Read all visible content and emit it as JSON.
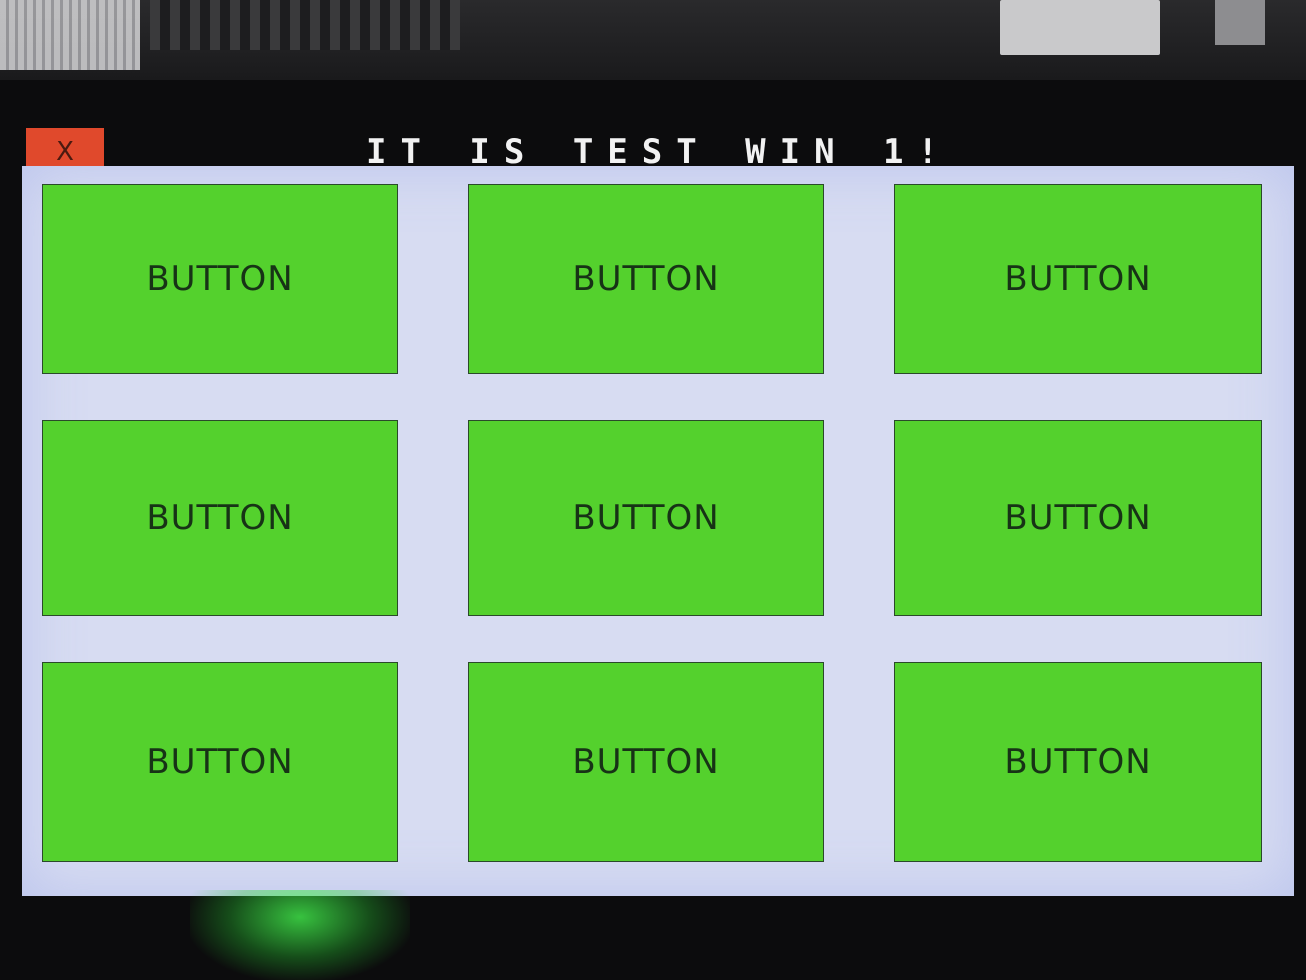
{
  "window": {
    "title": "IT IS TEST WIN 1!",
    "close_label": "X"
  },
  "buttons": [
    {
      "label": "BUTTON"
    },
    {
      "label": "BUTTON"
    },
    {
      "label": "BUTTON"
    },
    {
      "label": "BUTTON"
    },
    {
      "label": "BUTTON"
    },
    {
      "label": "BUTTON"
    },
    {
      "label": "BUTTON"
    },
    {
      "label": "BUTTON"
    },
    {
      "label": "BUTTON"
    }
  ],
  "colors": {
    "button_fill": "#54d12d",
    "client_background": "#d7dcf2",
    "close_button": "#e0492c",
    "title_text": "#f2f2f2"
  }
}
